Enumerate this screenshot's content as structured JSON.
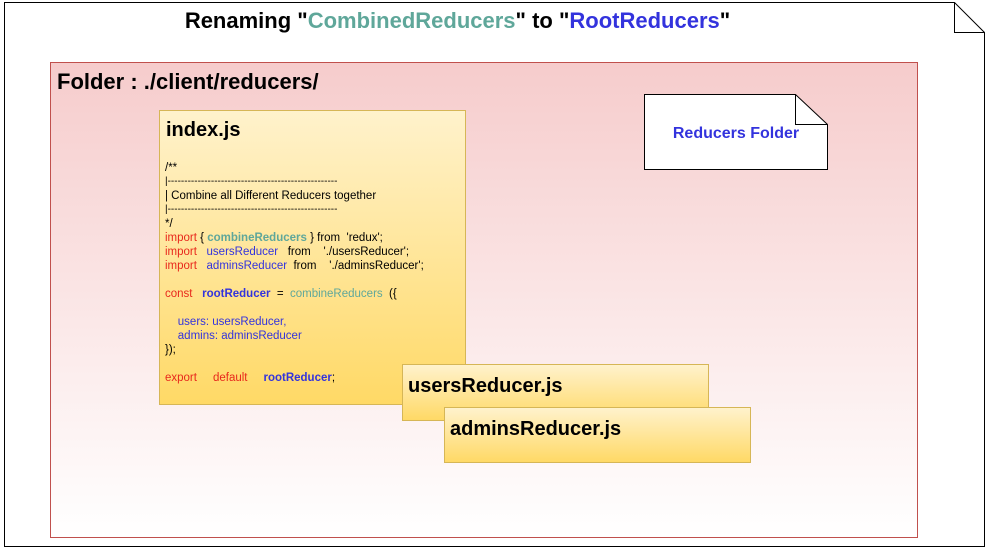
{
  "title": {
    "prefix": "Renaming \"",
    "old_name": "CombinedReducers",
    "middle": "\" to \"",
    "new_name": "RootReducers",
    "suffix": "\""
  },
  "folder": {
    "label": "Folder :   ./client/reducers/",
    "note_label": "Reducers Folder"
  },
  "index_file": {
    "name": "index.js",
    "code": {
      "c1": "/**",
      "c2": "|---------------------------------------------------",
      "c3": "| Combine all Different Reducers together",
      "c4": "|---------------------------------------------------",
      "c5": "*/",
      "i1_kw": "import",
      "i1_a": " { ",
      "i1_fn": "combineReducers",
      "i1_b": " } from  'redux';",
      "i2_kw": "import",
      "i2_name": "   usersReducer",
      "i2_rest": "   from    './usersReducer';",
      "i3_kw": "import",
      "i3_name": "   adminsReducer",
      "i3_rest": "  from    './adminsReducer';",
      "r_kw": "const",
      "r_name": "rootReducer",
      "r_eq": "  =  ",
      "r_fn": "combineReducers",
      "r_end": "  ({",
      "u_line": "    users: usersReducer,",
      "a_line": "    admins: adminsReducer",
      "close": "});",
      "e_kw1": "export",
      "e_kw2": "default",
      "e_name": "rootReducer",
      "e_end": ";"
    }
  },
  "files": {
    "users": "usersReducer.js",
    "admins": "adminsReducer.js"
  },
  "colors": {
    "green": "#5fa79a",
    "blue": "#3333dd",
    "keyword_red": "#e8281c",
    "card_border": "#d6b656",
    "folder_border": "#c0504d"
  }
}
